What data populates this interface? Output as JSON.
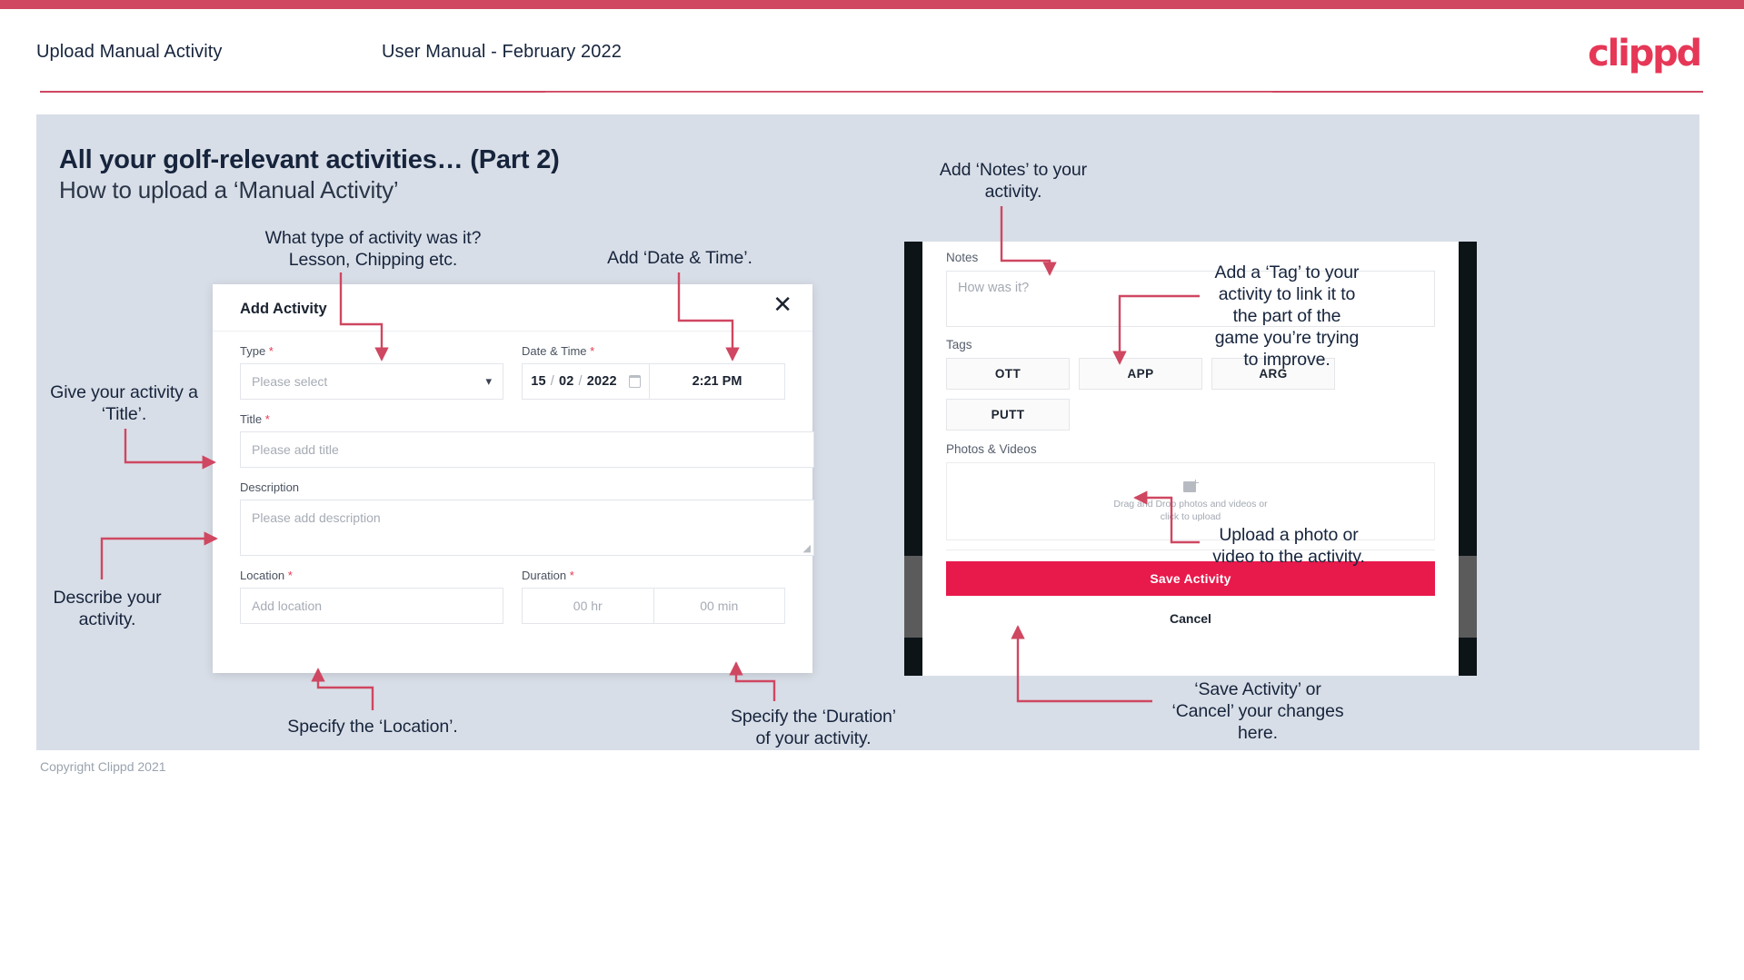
{
  "header": {
    "title": "Upload Manual Activity",
    "subtitle": "User Manual - February 2022",
    "logo": "clippd"
  },
  "slide": {
    "title": "All your golf-relevant activities… (Part 2)",
    "subtitle": "How to upload a ‘Manual Activity’"
  },
  "footer": {
    "copyright": "Copyright Clippd 2021"
  },
  "colors": {
    "brand_crimson": "#cf4761",
    "accent_pink": "#e8194b",
    "logo_red": "#e63757",
    "slide_bg": "#d8dee7",
    "text_dark": "#16243c",
    "required_red": "#e8394f",
    "arrow_red": "#cf4761"
  },
  "modal": {
    "title": "Add Activity",
    "close_icon": "close-icon",
    "fields": {
      "type": {
        "label": "Type",
        "required": true,
        "placeholder": "Please select",
        "chevron": "chevron-down-icon"
      },
      "datetime": {
        "label": "Date & Time",
        "required": true,
        "day": "15",
        "month": "02",
        "year": "2022",
        "separator": "/",
        "calendar_icon": "calendar-icon",
        "time": "2:21 PM"
      },
      "title": {
        "label": "Title",
        "required": true,
        "placeholder": "Please add title"
      },
      "description": {
        "label": "Description",
        "required": false,
        "placeholder": "Please add description"
      },
      "location": {
        "label": "Location",
        "required": true,
        "placeholder": "Add location"
      },
      "duration": {
        "label": "Duration",
        "required": true,
        "hours": "00 hr",
        "minutes": "00 min"
      }
    }
  },
  "phone": {
    "notes": {
      "label": "Notes",
      "placeholder": "How was it?"
    },
    "tags": {
      "label": "Tags",
      "options": [
        "OTT",
        "APP",
        "ARG",
        "PUTT"
      ]
    },
    "photos": {
      "label": "Photos & Videos",
      "icon": "add-image-icon",
      "drop_line1": "Drag and Drop photos and videos or",
      "drop_line2": "click to upload"
    },
    "save_label": "Save Activity",
    "cancel_label": "Cancel"
  },
  "annotations": {
    "type": "What type of activity was it?\nLesson, Chipping etc.",
    "datetime": "Add ‘Date & Time’.",
    "title": "Give your activity a\n‘Title’.",
    "description": "Describe your\nactivity.",
    "location": "Specify the ‘Location’.",
    "duration": "Specify the ‘Duration’\nof your activity.",
    "notes": "Add ‘Notes’ to your\nactivity.",
    "tags": "Add a ‘Tag’ to your\nactivity to link it to\nthe part of the\ngame you’re trying\nto improve.",
    "photos": "Upload a photo or\nvideo to the activity.",
    "save": "‘Save Activity’ or\n‘Cancel’ your changes\nhere."
  }
}
